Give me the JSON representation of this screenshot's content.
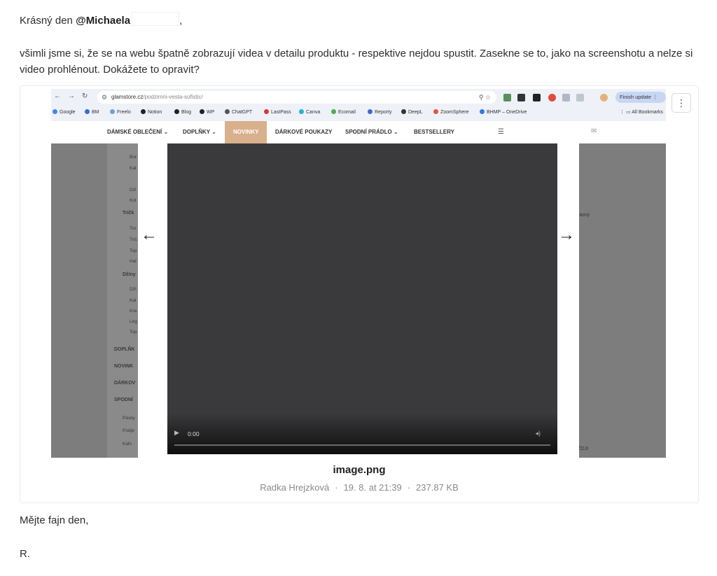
{
  "message": {
    "greeting_prefix": "Krásný den",
    "mention": "@Michaela",
    "greeting_suffix": ",",
    "body": "všimli jsme si, že se na webu špatně zobrazují videa v detailu produktu - respektive nejdou spustit. Zasekne se to, jako na screenshotu a nelze si video prohlénout. Dokážete to opravit?",
    "signoff": "Mějte fajn den,",
    "signature": "R."
  },
  "attachment": {
    "filename": "image.png",
    "author": "Radka Hrejzková",
    "date": "19. 8. at 21:39",
    "size": "237.87 KB",
    "more_icon": "more-vertical-icon"
  },
  "screenshot": {
    "browser": {
      "url_domain": "glamstore.cz",
      "url_path": "/podzimni-vesta-sofistic/",
      "update_label": "Finish update",
      "bookmarks": [
        "Google",
        "BM",
        "Freelo",
        "Notion",
        "Blog",
        "WP",
        "ChatGPT",
        "LastPass",
        "Canva",
        "Ecomail",
        "Reporty",
        "DeepL",
        "ZoomSphere",
        "BHMP – OneDrive"
      ],
      "all_bookmarks": "All Bookmarks"
    },
    "nav": {
      "items": [
        "DÁMSKÉ OBLEČENÍ",
        "DOPLŇKY",
        "NOVINKY",
        "DÁRKOVÉ POUKAZY",
        "SPODNÍ PRÁDLO",
        "BESTSELLERY"
      ]
    },
    "sidebar": {
      "items": [
        "Bur",
        "Kal",
        "Dži",
        "Kol",
        "Tričk",
        "Tur",
        "Trič",
        "Top",
        "Hal",
        "Džíny",
        "Dží",
        "Kal",
        "Kra",
        "Leg",
        "Top",
        "DOPLŇK",
        "NOVINK",
        "DÁRKOV",
        "SPODNÍ",
        "Pásky",
        "Podpr",
        "Kalh"
      ]
    },
    "video": {
      "time": "0:00"
    },
    "right_text_1": "rasný",
    "right_text_2": "ŽOJI"
  }
}
